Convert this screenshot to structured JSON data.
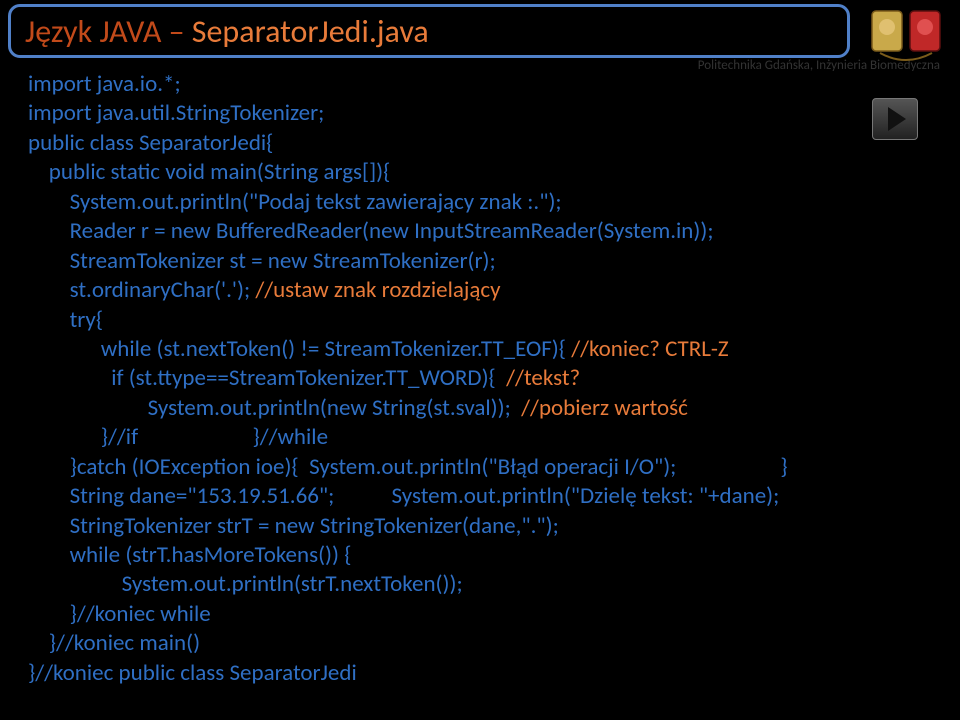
{
  "title": {
    "part1": "Język JAVA – ",
    "part2": "SeparatorJedi.java"
  },
  "subhead": "Politechnika Gdańska, Inżynieria Biomedyczna",
  "code": {
    "l01": "import java.io.*;",
    "l02": "import java.util.StringTokenizer;",
    "l03": "public class SeparatorJedi{",
    "l04": "    public static void main(String args[]){",
    "l05": "        System.out.println(\"Podaj tekst zawierający znak :.\");",
    "l06": "        Reader r = new BufferedReader(new InputStreamReader(System.in));",
    "l07": "        StreamTokenizer st = new StreamTokenizer(r);",
    "l08a": "        st.ordinaryChar('.'); ",
    "l08b": "//ustaw znak rozdzielający",
    "l09": "        try{",
    "l10a": "              while (st.nextToken() != StreamTokenizer.TT_EOF){ ",
    "l10b": "//koniec? CTRL-Z",
    "l11a": "                if (st.ttype==StreamTokenizer.TT_WORD){  ",
    "l11b": "//tekst?",
    "l12a": "                       System.out.println(new String(st.sval));  ",
    "l12b": "//pobierz wartość",
    "l13": "              }//if                      }//while",
    "l14": "        }catch (IOException ioe){  System.out.println(\"Błąd operacji I/O\");                    }",
    "l15": "        String dane=\"153.19.51.66\";           System.out.println(\"Dzielę tekst: \"+dane);",
    "l16": "        StringTokenizer strT = new StringTokenizer(dane,\".\");",
    "l17": "        while (strT.hasMoreTokens()) {",
    "l18": "                  System.out.println(strT.nextToken());",
    "l19": "        }//koniec while",
    "l20": "    }//koniec main()",
    "l21": "}//koniec public class SeparatorJedi"
  }
}
